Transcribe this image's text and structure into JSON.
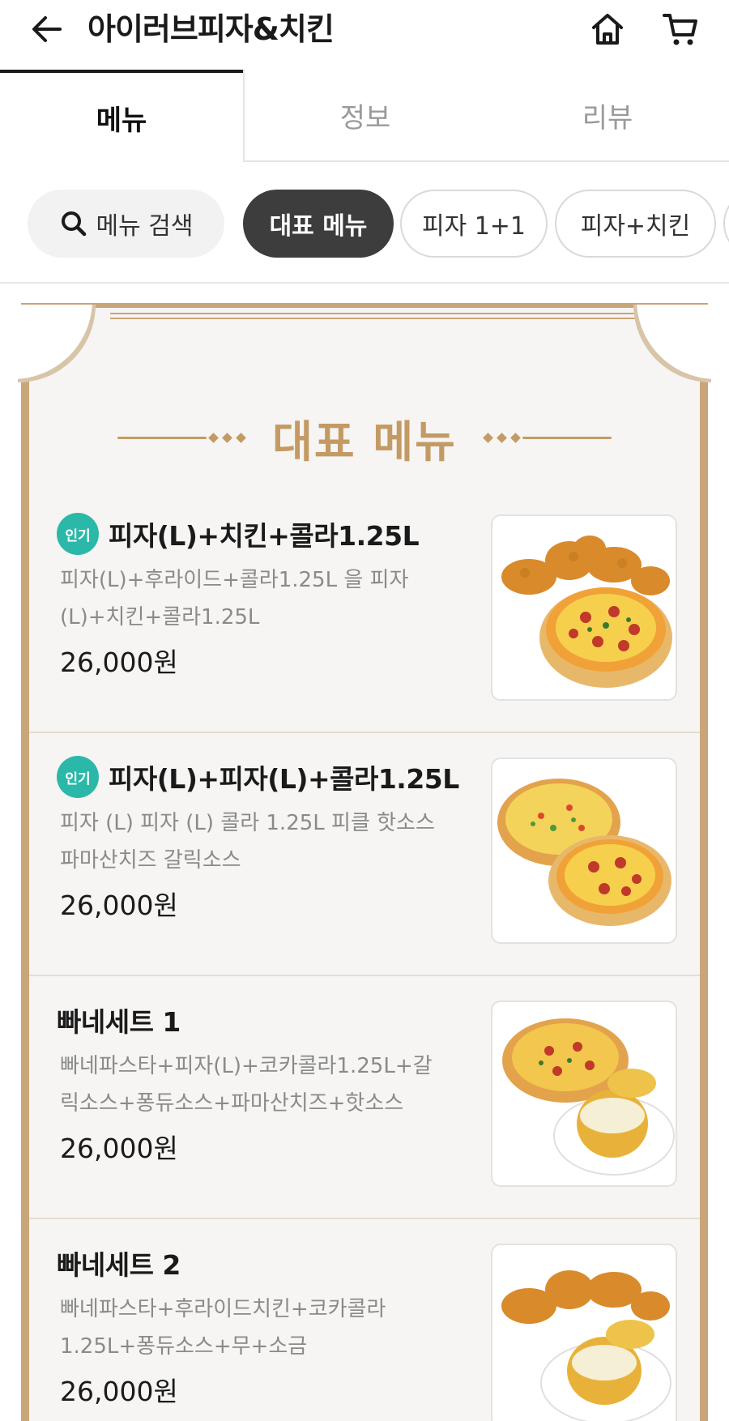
{
  "header": {
    "title": "아이러브피자&치킨",
    "back_icon": "arrow-left-icon",
    "home_icon": "home-icon",
    "cart_icon": "cart-icon"
  },
  "tabs": [
    {
      "label": "메뉴",
      "active": true
    },
    {
      "label": "정보",
      "active": false
    },
    {
      "label": "리뷰",
      "active": false
    }
  ],
  "chips": {
    "search_label": "메뉴 검색",
    "items": [
      {
        "label": "대표 메뉴",
        "selected": true
      },
      {
        "label": "피자 1+1",
        "selected": false
      },
      {
        "label": "피자+치킨",
        "selected": false
      }
    ]
  },
  "section": {
    "title": "대표 메뉴"
  },
  "menu_items": [
    {
      "badge": "인기",
      "name": "피자(L)+치킨+콜라1.25L",
      "description": "피자(L)+후라이드+콜라1.25L 을 피자(L)+치킨+콜라1.25L",
      "price": "26,000원",
      "image": "chicken-and-pizza"
    },
    {
      "badge": "인기",
      "name": "피자(L)+피자(L)+콜라1.25L",
      "description": "피자 (L) 피자 (L) 콜라 1.25L 피클 핫소스 파마산치즈 갈릭소스",
      "price": "26,000원",
      "image": "two-pizzas"
    },
    {
      "badge": "",
      "name": "빠네세트 1",
      "description": "빠네파스타+피자(L)+코카콜라1.25L+갈릭소스+퐁듀소스+파마산치즈+핫소스",
      "price": "26,000원",
      "image": "pizza-and-pane-pasta"
    },
    {
      "badge": "",
      "name": "빠네세트 2",
      "description": "빠네파스타+후라이드치킨+코카콜라1.25L+퐁듀소스+무+소금",
      "price": "26,000원",
      "image": "chicken-and-pane-pasta"
    }
  ],
  "colors": {
    "accent_gold": "#c49a64",
    "badge_teal": "#2bb8a8",
    "chip_selected": "#3d3d3d"
  }
}
